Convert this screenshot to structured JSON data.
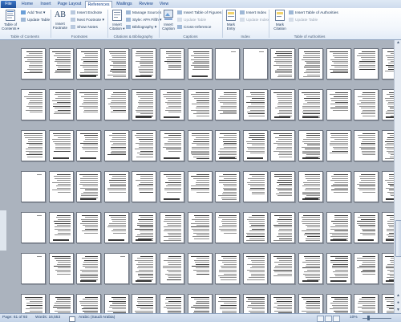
{
  "tabs": [
    "File",
    "Home",
    "Insert",
    "Page Layout",
    "References",
    "Mailings",
    "Review",
    "View"
  ],
  "active_tab": "References",
  "ribbon": {
    "toc": {
      "big_label_1": "Table of",
      "big_label_2": "Contents ▾",
      "add_text": "Add Text ▾",
      "update_table": "Update Table",
      "group": "Table of Contents"
    },
    "footnotes": {
      "insert_footnote_1": "Insert",
      "insert_footnote_2": "Footnote",
      "insert_endnote": "Insert Endnote",
      "next_footnote": "Next Footnote ▾",
      "show_notes": "Show Notes",
      "group": "Footnotes"
    },
    "citations": {
      "insert_citation_1": "Insert",
      "insert_citation_2": "Citation ▾",
      "manage_sources": "Manage Sources",
      "style_label": "Style:",
      "style_value": "APA Fifth ▾",
      "bibliography": "Bibliography ▾",
      "group": "Citations & Bibliography"
    },
    "captions": {
      "insert_caption_1": "Insert",
      "insert_caption_2": "Caption",
      "insert_table_of_figures": "Insert Table of Figures",
      "update_table": "Update Table",
      "cross_reference": "Cross-reference",
      "group": "Captions"
    },
    "index": {
      "mark_entry_1": "Mark",
      "mark_entry_2": "Entry",
      "insert_index": "Insert Index",
      "update_index": "Update Index",
      "group": "Index"
    },
    "authorities": {
      "mark_citation_1": "Mark",
      "mark_citation_2": "Citation",
      "insert_table_of_authorities": "Insert Table of Authorities",
      "update_table": "Update Table",
      "group": "Table of Authorities"
    }
  },
  "status": {
    "page": "Page: 61 of 93",
    "words": "Words: 16,553",
    "language": "Arabic (Saudi Arabia)",
    "zoom": "10%"
  },
  "document": {
    "columns": 14,
    "rows_visible": 6,
    "first_row_blank_pages": [
      7,
      8
    ],
    "blank_pages_row_4": [
      0
    ],
    "blank_pages_row_5": [
      0
    ],
    "blank_pages_row_6": [
      0,
      3
    ]
  },
  "colors": {
    "accent": "#1f4f99",
    "canvas": "#abb3be",
    "ribbon_text": "#1e395b"
  }
}
